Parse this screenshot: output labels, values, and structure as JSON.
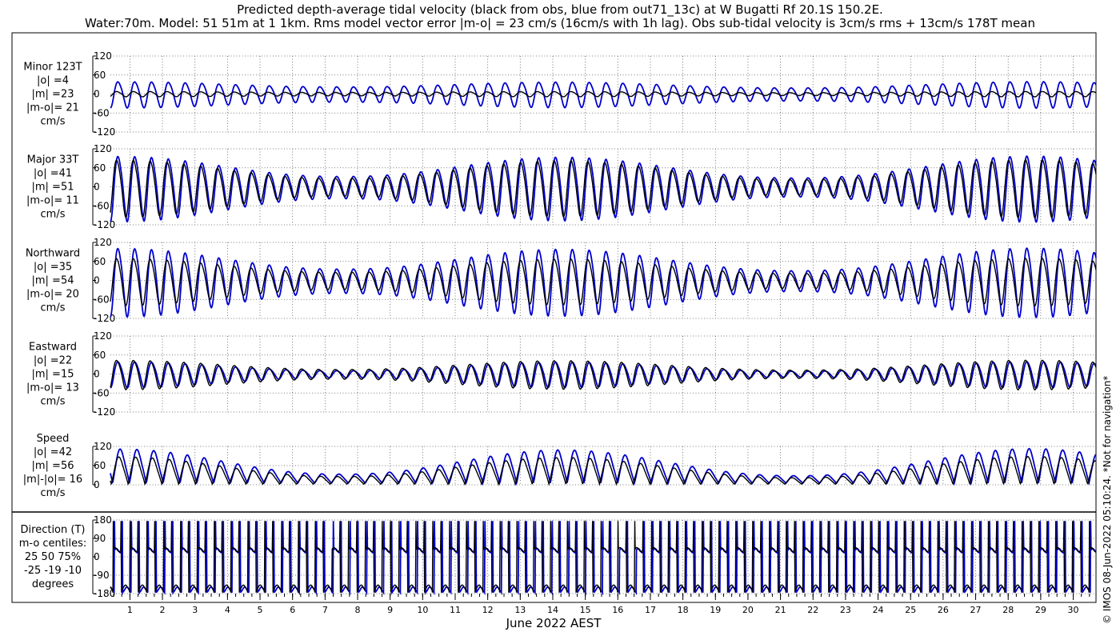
{
  "title_line1": "Predicted depth-average tidal velocity (black from obs, blue from out71_13c) at W Bugatti Rf 20.1S 150.2E.",
  "title_line2": "Water:70m. Model: 51 51m at 1 1km. Rms model vector error |m-o| = 23 cm/s (16cm/s with 1h lag). Obs sub-tidal velocity is 3cm/s rms + 13cm/s 178T mean",
  "xlabel": "June 2022 AEST",
  "copyright": "© IMOS 08-Jun-2022 05:10:24. *Not for navigation*",
  "colors": {
    "obs": "#000000",
    "model": "#0000cc"
  },
  "chart_data": [
    {
      "type": "line",
      "panel": "minor",
      "label_lines": [
        "Minor 123T",
        "|o| =4",
        "|m| =23",
        "|m-o|= 21",
        "cm/s"
      ],
      "yticks": [
        "120",
        "60",
        "0",
        "-60",
        "-120"
      ],
      "ylim": [
        -120,
        120
      ],
      "x_unit": "day of June 2022",
      "series": [
        {
          "name": "obs",
          "amplitude_range": [
            5,
            8
          ],
          "mean": 0
        },
        {
          "name": "model",
          "amplitude_range": [
            22,
            40
          ],
          "mean": 0
        }
      ]
    },
    {
      "type": "line",
      "panel": "major",
      "label_lines": [
        "Major 33T",
        "|o| =41",
        "|m| =51",
        "|m-o|= 11",
        "cm/s"
      ],
      "yticks": [
        "120",
        "60",
        "0",
        "-60",
        "-120"
      ],
      "ylim": [
        -120,
        120
      ],
      "series": [
        {
          "name": "obs",
          "amplitude_range": [
            26,
            88
          ],
          "mean": 0
        },
        {
          "name": "model",
          "amplitude_range": [
            32,
            100
          ],
          "mean": 0
        }
      ]
    },
    {
      "type": "line",
      "panel": "northward",
      "label_lines": [
        "Northward",
        "|o| =35",
        "|m| =54",
        "|m-o|= 20",
        "cm/s"
      ],
      "yticks": [
        "120",
        "60",
        "0",
        "-60",
        "-120"
      ],
      "ylim": [
        -120,
        120
      ],
      "series": [
        {
          "name": "obs",
          "amplitude_range": [
            25,
            72
          ],
          "mean": 0
        },
        {
          "name": "model",
          "amplitude_range": [
            35,
            105
          ],
          "mean": 0
        }
      ]
    },
    {
      "type": "line",
      "panel": "eastward",
      "label_lines": [
        "Eastward",
        "|o| =22",
        "|m| =15",
        "|m-o|= 13",
        "cm/s"
      ],
      "yticks": [
        "120",
        "60",
        "0",
        "-60",
        "-120"
      ],
      "ylim": [
        -120,
        120
      ],
      "series": [
        {
          "name": "obs",
          "amplitude_range": [
            14,
            45
          ],
          "mean": 0
        },
        {
          "name": "model",
          "amplitude_range": [
            10,
            40
          ],
          "mean": 0
        }
      ]
    },
    {
      "type": "line",
      "panel": "speed",
      "label_lines": [
        "Speed",
        "|o| =42",
        "|m| =56",
        "|m|-|o|= 16",
        "cm/s"
      ],
      "yticks": [
        "120",
        "60",
        "0"
      ],
      "ylim": [
        0,
        120
      ],
      "series": [
        {
          "name": "obs",
          "max_range": [
            25,
            90
          ],
          "min": 2
        },
        {
          "name": "model",
          "max_range": [
            32,
            115
          ],
          "min": 5
        }
      ]
    },
    {
      "type": "line",
      "panel": "direction",
      "label_lines": [
        "Direction (T)",
        "m-o centiles:",
        "25  50  75%",
        "-25 -19 -10",
        "degrees"
      ],
      "yticks": [
        "180",
        "90",
        "0",
        "-90",
        "-180"
      ],
      "ylim": [
        -180,
        180
      ],
      "series": [
        {
          "name": "obs",
          "flood_deg": 35,
          "ebb_deg": -150
        },
        {
          "name": "model",
          "flood_deg": 30,
          "ebb_deg": -160
        }
      ]
    }
  ],
  "x_axis": {
    "range": [
      0.4,
      30.7
    ],
    "days": [
      "1",
      "2",
      "3",
      "4",
      "5",
      "6",
      "7",
      "8",
      "9",
      "10",
      "11",
      "12",
      "13",
      "14",
      "15",
      "16",
      "17",
      "18",
      "19",
      "20",
      "21",
      "22",
      "23",
      "24",
      "25",
      "26",
      "27",
      "28",
      "29",
      "30"
    ],
    "spring_tide_days": [
      0.5,
      14.5,
      30.5
    ],
    "neap_tide_days": [
      6.5,
      22.5
    ],
    "tidal_period_hours": 12.42
  }
}
